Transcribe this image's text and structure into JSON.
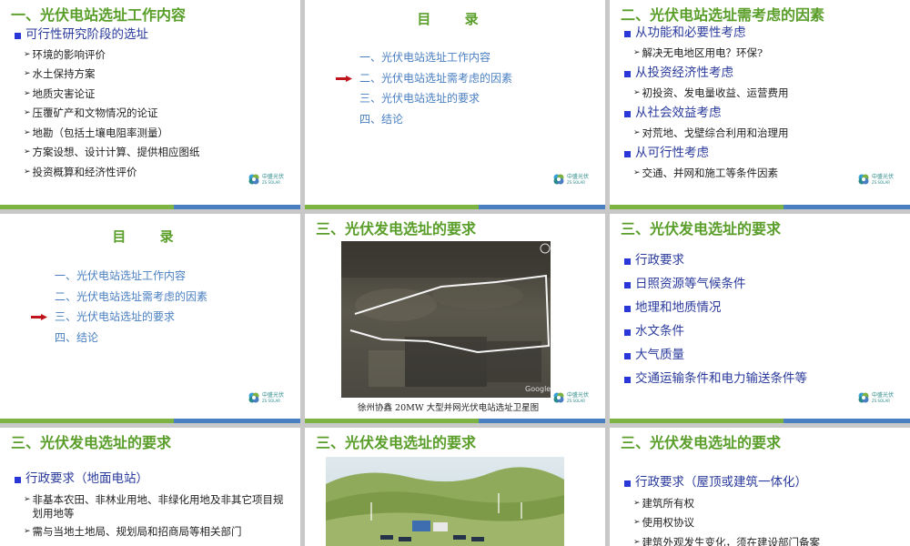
{
  "slides": [
    {
      "title": "一、光伏电站选址工作内容",
      "heading": "可行性研究阶段的选址",
      "items": [
        "环境的影响评价",
        "水土保持方案",
        "地质灾害论证",
        "压覆矿产和文物情况的论证",
        "地勘（包括土壤电阻率测量）",
        "方案设想、设计计算、提供相应图纸",
        "投资概算和经济性评价"
      ]
    },
    {
      "title": "目  录",
      "items": [
        "一、光伏电站选址工作内容",
        "二、光伏电站选址需考虑的因素",
        "三、光伏电站选址的要求",
        "四、结论"
      ],
      "current_index": 1
    },
    {
      "title": "二、光伏电站选址需考虑的因素",
      "groups": [
        {
          "heading": "从功能和必要性考虑",
          "sub": "解决无电地区用电？环保?"
        },
        {
          "heading": "从投资经济性考虑",
          "sub": "初投资、发电量收益、运营费用"
        },
        {
          "heading": "从社会效益考虑",
          "sub": "对荒地、戈壁综合利用和治理用"
        },
        {
          "heading": "从可行性考虑",
          "sub": "交通、并网和施工等条件因素"
        }
      ]
    },
    {
      "title": "目  录",
      "items": [
        "一、光伏电站选址工作内容",
        "二、光伏电站选址需考虑的因素",
        "三、光伏电站选址的要求",
        "四、结论"
      ],
      "current_index": 2
    },
    {
      "title": "三、光伏发电选址的要求",
      "image_caption": "徐州协鑫 20MW 大型并网光伏电站选址卫星图",
      "image_watermark": "Google"
    },
    {
      "title": "三、光伏发电选址的要求",
      "items": [
        "行政要求",
        "日照资源等气候条件",
        "地理和地质情况",
        "水文条件",
        "大气质量",
        "交通运输条件和电力输送条件等"
      ]
    },
    {
      "title": "三、光伏发电选址的要求",
      "heading": "行政要求（地面电站）",
      "items": [
        "非基本农田、非林业用地、非绿化用地及非其它项目规划用地等",
        "需与当地土地局、规划局和招商局等相关部门"
      ]
    },
    {
      "title": "三、光伏发电选址的要求"
    },
    {
      "title": "三、光伏发电选址的要求",
      "heading": "行政要求（屋顶或建筑一体化）",
      "items": [
        "建筑所有权",
        "使用权协议",
        "建筑外观发生变化，须在建设部门备案"
      ]
    }
  ],
  "logo": {
    "name": "中盛光伏",
    "sub": "ZS SOLAR"
  },
  "colors": {
    "title_green": "#5a9e2a",
    "bullet_blue": "#2a37d8",
    "toc_blue": "#4a7fc1",
    "bar_green": "#7cb342",
    "bar_blue": "#4a7fc1",
    "arrow_red": "#c0141c"
  }
}
